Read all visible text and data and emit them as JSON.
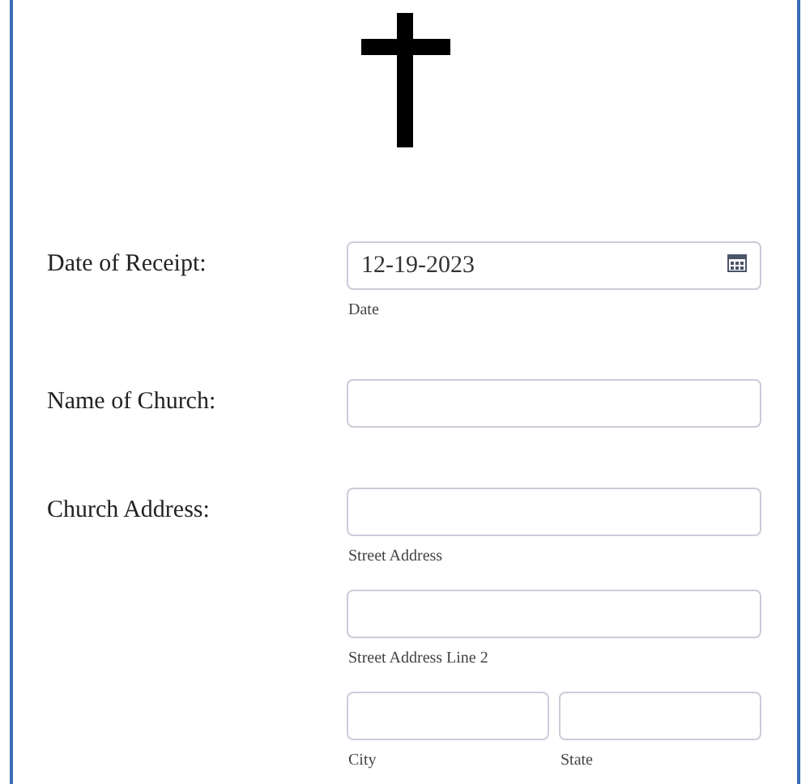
{
  "fields": [
    {
      "label": "Date of Receipt:",
      "inputs": [
        {
          "kind": "date",
          "value": "12-19-2023",
          "sublabel": "Date"
        }
      ]
    },
    {
      "label": "Name of Church:",
      "inputs": [
        {
          "kind": "text"
        }
      ]
    },
    {
      "label": "Church Address:",
      "inputs": [
        {
          "kind": "text",
          "sublabel": "Street Address"
        },
        {
          "kind": "text",
          "sublabel": "Street Address Line 2"
        },
        {
          "kind": "pair",
          "parts": [
            {
              "sublabel": "City"
            },
            {
              "sublabel": "State"
            }
          ]
        }
      ]
    }
  ]
}
